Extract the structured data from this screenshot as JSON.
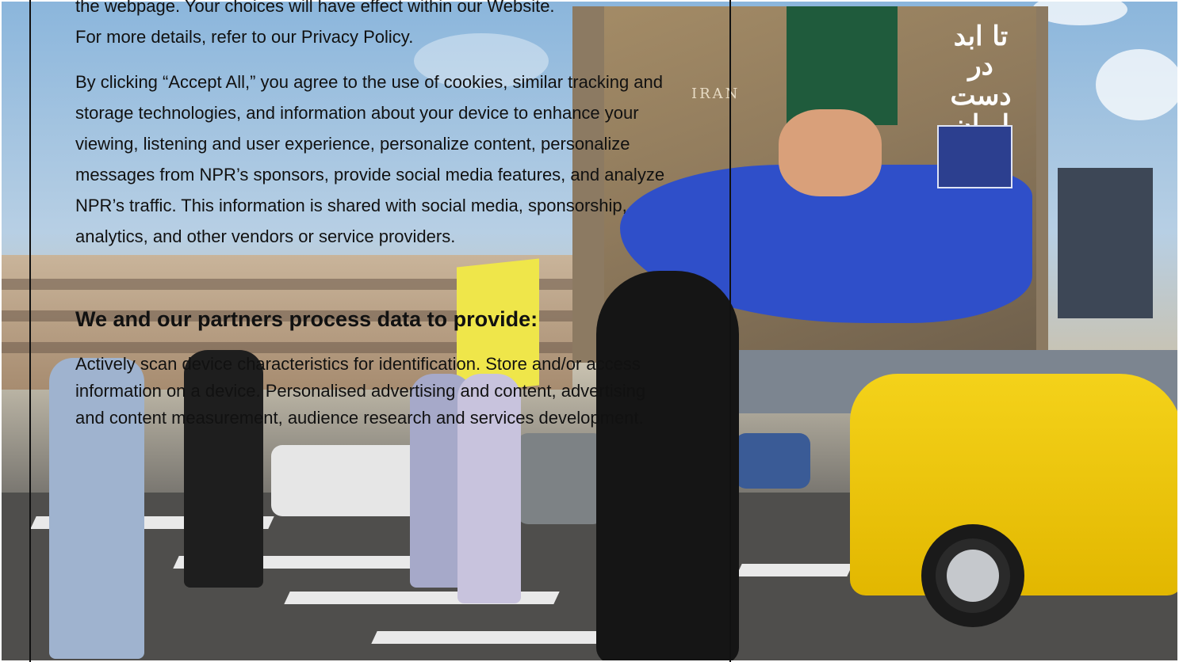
{
  "consent_panel": {
    "paragraph_intro_tail_line1": "the webpage. Your choices will have effect within our Website.",
    "paragraph_intro_tail_line2_prefix": "For more details, refer to our ",
    "privacy_policy_link": "Privacy Policy",
    "paragraph_intro_tail_line2_suffix": ".",
    "paragraph_accept": "By clicking “Accept All,” you agree to the use of cookies, similar tracking and storage technologies, and information about your device to enhance your viewing, listening and user experience, personalize content, personalize messages from NPR’s sponsors, provide social media features, and analyze NPR’s traffic. This information is shared with social media, sponsorship, analytics, and other vendors or service providers.",
    "partners_heading": "We and our partners process data to provide:",
    "purposes_text": "Actively scan device characteristics for identification. Store and/or access information on a device. Personalised advertising and content, advertising and content measurement, audience research and services development."
  },
  "background_image": {
    "mural_script": "تا ابد در دست ایران",
    "mural_building_label": "IRAN"
  },
  "colors": {
    "text": "#111111",
    "taxi_yellow": "#f4d21a",
    "mural_blue": "#2f4fc9"
  }
}
